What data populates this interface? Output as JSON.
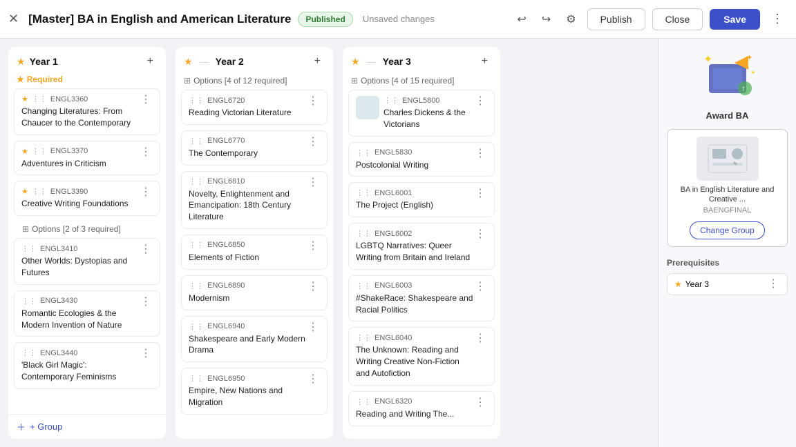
{
  "header": {
    "title": "[Master] BA in English and American Literature",
    "status": "Published",
    "unsaved": "Unsaved changes",
    "publish_label": "Publish",
    "close_label": "Close",
    "save_label": "Save"
  },
  "columns": [
    {
      "id": "year1",
      "label": "Year 1",
      "required_label": "Required",
      "sections": [
        {
          "type": "required",
          "cards": [
            {
              "code": "ENGL3360",
              "star": true,
              "title": "Changing Literatures: From Chaucer to the Contemporary"
            },
            {
              "code": "ENGL3370",
              "star": true,
              "title": "Adventures in Criticism"
            },
            {
              "code": "ENGL3390",
              "star": true,
              "title": "Creative Writing Foundations"
            }
          ]
        },
        {
          "type": "options",
          "label": "Options [2 of 3 required]",
          "cards": [
            {
              "code": "ENGL3410",
              "star": false,
              "title": "Other Worlds: Dystopias and Futures"
            },
            {
              "code": "ENGL3430",
              "star": false,
              "title": "Romantic Ecologies & the Modern Invention of Nature"
            },
            {
              "code": "ENGL3440",
              "star": false,
              "title": "'Black Girl Magic': Contemporary Feminisms"
            }
          ]
        }
      ]
    },
    {
      "id": "year2",
      "label": "Year 2",
      "sections": [
        {
          "type": "options",
          "label": "Options [4 of 12 required]",
          "cards": [
            {
              "code": "ENGL6720",
              "star": false,
              "title": "Reading Victorian Literature"
            },
            {
              "code": "ENGL6770",
              "star": false,
              "title": "The Contemporary"
            },
            {
              "code": "ENGL6810",
              "star": false,
              "title": "Novelty, Enlightenment and Emancipation: 18th Century Literature"
            },
            {
              "code": "ENGL6850",
              "star": false,
              "title": "Elements of Fiction"
            },
            {
              "code": "ENGL6890",
              "star": false,
              "title": "Modernism"
            },
            {
              "code": "ENGL6940",
              "star": false,
              "title": "Shakespeare and Early Modern Drama"
            },
            {
              "code": "ENGL6950",
              "star": false,
              "title": "Empire, New Nations and Migration"
            }
          ]
        }
      ]
    },
    {
      "id": "year3",
      "label": "Year 3",
      "sections": [
        {
          "type": "options",
          "label": "Options [4 of 15 required]",
          "cards": [
            {
              "code": "ENGL5800",
              "star": false,
              "title": "Charles Dickens & the Victorians"
            },
            {
              "code": "ENGL5830",
              "star": false,
              "title": "Postcolonial Writing"
            },
            {
              "code": "ENGL6001",
              "star": false,
              "title": "The Project (English)"
            },
            {
              "code": "ENGL6002",
              "star": false,
              "title": "LGBTQ Narratives: Queer Writing from Britain and Ireland"
            },
            {
              "code": "ENGL6003",
              "star": false,
              "title": "#ShakeRace: Shakespeare and Racial Politics"
            },
            {
              "code": "ENGL6040",
              "star": false,
              "title": "The Unknown: Reading and Writing Creative Non-Fiction and Autofiction"
            },
            {
              "code": "ENGL6320",
              "star": false,
              "title": "Reading and Writing The..."
            }
          ]
        }
      ]
    }
  ],
  "right_panel": {
    "award_label": "Award BA",
    "credential": {
      "name": "BA in English Literature and Creative ...",
      "code": "BAENGFINAL",
      "change_group_label": "Change Group"
    },
    "prerequisites_title": "Prerequisites",
    "prereq_item": "Year 3"
  },
  "add_group_label": "+ Group"
}
